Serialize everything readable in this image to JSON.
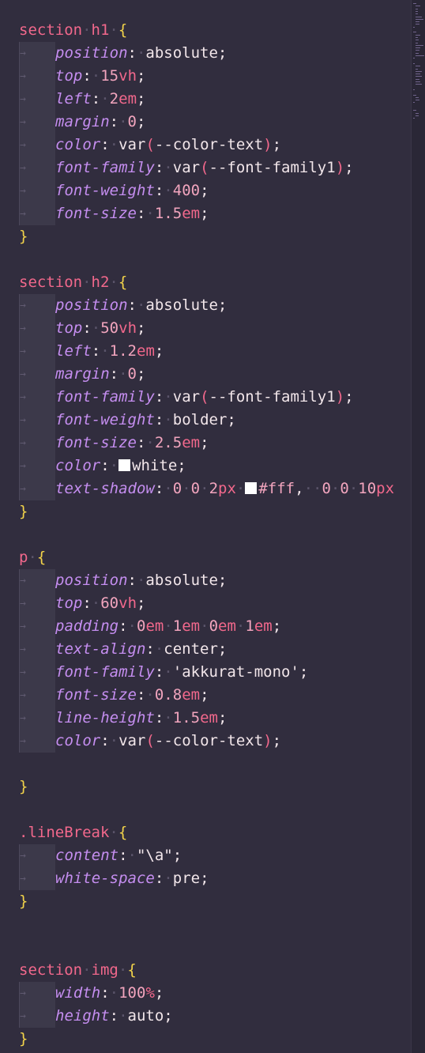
{
  "editor": {
    "language": "css",
    "theme_colors": {
      "background": "#312d3e",
      "selector": "#f2688c",
      "brace": "#f2d34a",
      "property": "#c58ef0",
      "number": "#f2a5be",
      "text": "#f2e6ea"
    },
    "code_lines": [
      {
        "indent": false,
        "tokens": [
          {
            "type": "sel",
            "text": "section"
          },
          {
            "type": "dot",
            "text": "·"
          },
          {
            "type": "sel",
            "text": "h1"
          },
          {
            "type": "dot",
            "text": "·"
          },
          {
            "type": "brace",
            "text": "{"
          }
        ]
      },
      {
        "indent": true,
        "tokens": [
          {
            "type": "prop",
            "text": "position"
          },
          {
            "type": "colon",
            "text": ":"
          },
          {
            "type": "dot",
            "text": "·"
          },
          {
            "type": "str",
            "text": "absolute;"
          }
        ]
      },
      {
        "indent": true,
        "tokens": [
          {
            "type": "prop",
            "text": "top"
          },
          {
            "type": "colon",
            "text": ":"
          },
          {
            "type": "dot",
            "text": "·"
          },
          {
            "type": "num",
            "text": "15"
          },
          {
            "type": "unit",
            "text": "vh"
          },
          {
            "type": "str",
            "text": ";"
          }
        ]
      },
      {
        "indent": true,
        "tokens": [
          {
            "type": "prop",
            "text": "left"
          },
          {
            "type": "colon",
            "text": ":"
          },
          {
            "type": "dot",
            "text": "·"
          },
          {
            "type": "num",
            "text": "2"
          },
          {
            "type": "unit",
            "text": "em"
          },
          {
            "type": "str",
            "text": ";"
          }
        ]
      },
      {
        "indent": true,
        "tokens": [
          {
            "type": "prop",
            "text": "margin"
          },
          {
            "type": "colon",
            "text": ":"
          },
          {
            "type": "dot",
            "text": "·"
          },
          {
            "type": "num",
            "text": "0"
          },
          {
            "type": "str",
            "text": ";"
          }
        ]
      },
      {
        "indent": true,
        "tokens": [
          {
            "type": "prop",
            "text": "color"
          },
          {
            "type": "colon",
            "text": ":"
          },
          {
            "type": "dot",
            "text": "·"
          },
          {
            "type": "str",
            "text": "var"
          },
          {
            "type": "paren",
            "text": "("
          },
          {
            "type": "str",
            "text": "--color-text"
          },
          {
            "type": "paren",
            "text": ")"
          },
          {
            "type": "str",
            "text": ";"
          }
        ]
      },
      {
        "indent": true,
        "tokens": [
          {
            "type": "prop",
            "text": "font-family"
          },
          {
            "type": "colon",
            "text": ":"
          },
          {
            "type": "dot",
            "text": "·"
          },
          {
            "type": "str",
            "text": "var"
          },
          {
            "type": "paren",
            "text": "("
          },
          {
            "type": "str",
            "text": "--font-family1"
          },
          {
            "type": "paren",
            "text": ")"
          },
          {
            "type": "str",
            "text": ";"
          }
        ]
      },
      {
        "indent": true,
        "tokens": [
          {
            "type": "prop",
            "text": "font-weight"
          },
          {
            "type": "colon",
            "text": ":"
          },
          {
            "type": "dot",
            "text": "·"
          },
          {
            "type": "num",
            "text": "400"
          },
          {
            "type": "str",
            "text": ";"
          }
        ]
      },
      {
        "indent": true,
        "tokens": [
          {
            "type": "prop",
            "text": "font-size"
          },
          {
            "type": "colon",
            "text": ":"
          },
          {
            "type": "dot",
            "text": "·"
          },
          {
            "type": "num",
            "text": "1.5"
          },
          {
            "type": "unit",
            "text": "em"
          },
          {
            "type": "str",
            "text": ";"
          }
        ]
      },
      {
        "indent": false,
        "tokens": [
          {
            "type": "brace",
            "text": "}"
          }
        ]
      },
      {
        "indent": false,
        "tokens": []
      },
      {
        "indent": false,
        "tokens": [
          {
            "type": "sel",
            "text": "section"
          },
          {
            "type": "dot",
            "text": "·"
          },
          {
            "type": "sel",
            "text": "h2"
          },
          {
            "type": "dot",
            "text": "·"
          },
          {
            "type": "brace",
            "text": "{"
          }
        ]
      },
      {
        "indent": true,
        "tokens": [
          {
            "type": "prop",
            "text": "position"
          },
          {
            "type": "colon",
            "text": ":"
          },
          {
            "type": "dot",
            "text": "·"
          },
          {
            "type": "str",
            "text": "absolute;"
          }
        ]
      },
      {
        "indent": true,
        "tokens": [
          {
            "type": "prop",
            "text": "top"
          },
          {
            "type": "colon",
            "text": ":"
          },
          {
            "type": "dot",
            "text": "·"
          },
          {
            "type": "num",
            "text": "50"
          },
          {
            "type": "unit",
            "text": "vh"
          },
          {
            "type": "str",
            "text": ";"
          }
        ]
      },
      {
        "indent": true,
        "tokens": [
          {
            "type": "prop",
            "text": "left"
          },
          {
            "type": "colon",
            "text": ":"
          },
          {
            "type": "dot",
            "text": "·"
          },
          {
            "type": "num",
            "text": "1.2"
          },
          {
            "type": "unit",
            "text": "em"
          },
          {
            "type": "str",
            "text": ";"
          }
        ]
      },
      {
        "indent": true,
        "tokens": [
          {
            "type": "prop",
            "text": "margin"
          },
          {
            "type": "colon",
            "text": ":"
          },
          {
            "type": "dot",
            "text": "·"
          },
          {
            "type": "num",
            "text": "0"
          },
          {
            "type": "str",
            "text": ";"
          }
        ]
      },
      {
        "indent": true,
        "tokens": [
          {
            "type": "prop",
            "text": "font-family"
          },
          {
            "type": "colon",
            "text": ":"
          },
          {
            "type": "dot",
            "text": "·"
          },
          {
            "type": "str",
            "text": "var"
          },
          {
            "type": "paren",
            "text": "("
          },
          {
            "type": "str",
            "text": "--font-family1"
          },
          {
            "type": "paren",
            "text": ")"
          },
          {
            "type": "str",
            "text": ";"
          }
        ]
      },
      {
        "indent": true,
        "tokens": [
          {
            "type": "prop",
            "text": "font-weight"
          },
          {
            "type": "colon",
            "text": ":"
          },
          {
            "type": "dot",
            "text": "·"
          },
          {
            "type": "str",
            "text": "bolder;"
          }
        ]
      },
      {
        "indent": true,
        "tokens": [
          {
            "type": "prop",
            "text": "font-size"
          },
          {
            "type": "colon",
            "text": ":"
          },
          {
            "type": "dot",
            "text": "·"
          },
          {
            "type": "num",
            "text": "2.5"
          },
          {
            "type": "unit",
            "text": "em"
          },
          {
            "type": "str",
            "text": ";"
          }
        ]
      },
      {
        "indent": true,
        "tokens": [
          {
            "type": "prop",
            "text": "color"
          },
          {
            "type": "colon",
            "text": ":"
          },
          {
            "type": "dot",
            "text": "·"
          },
          {
            "type": "swatch",
            "text": ""
          },
          {
            "type": "str",
            "text": "white;"
          }
        ]
      },
      {
        "indent": true,
        "tokens": [
          {
            "type": "prop",
            "text": "text-shadow"
          },
          {
            "type": "colon",
            "text": ":"
          },
          {
            "type": "dot",
            "text": "·"
          },
          {
            "type": "num",
            "text": "0"
          },
          {
            "type": "dot",
            "text": "·"
          },
          {
            "type": "num",
            "text": "0"
          },
          {
            "type": "dot",
            "text": "·"
          },
          {
            "type": "num",
            "text": "2"
          },
          {
            "type": "unit",
            "text": "px"
          },
          {
            "type": "dot",
            "text": "·"
          },
          {
            "type": "swatch",
            "text": ""
          },
          {
            "type": "num",
            "text": "#fff"
          },
          {
            "type": "str",
            "text": ","
          },
          {
            "type": "dot",
            "text": "··"
          },
          {
            "type": "num",
            "text": "0"
          },
          {
            "type": "dot",
            "text": "·"
          },
          {
            "type": "num",
            "text": "0"
          },
          {
            "type": "dot",
            "text": "·"
          },
          {
            "type": "num",
            "text": "10"
          },
          {
            "type": "unit",
            "text": "px"
          }
        ]
      },
      {
        "indent": false,
        "tokens": [
          {
            "type": "brace",
            "text": "}"
          }
        ]
      },
      {
        "indent": false,
        "tokens": []
      },
      {
        "indent": false,
        "tokens": [
          {
            "type": "sel",
            "text": "p"
          },
          {
            "type": "dot",
            "text": "·"
          },
          {
            "type": "brace",
            "text": "{"
          }
        ]
      },
      {
        "indent": true,
        "tokens": [
          {
            "type": "prop",
            "text": "position"
          },
          {
            "type": "colon",
            "text": ":"
          },
          {
            "type": "dot",
            "text": "·"
          },
          {
            "type": "str",
            "text": "absolute;"
          }
        ]
      },
      {
        "indent": true,
        "tokens": [
          {
            "type": "prop",
            "text": "top"
          },
          {
            "type": "colon",
            "text": ":"
          },
          {
            "type": "dot",
            "text": "·"
          },
          {
            "type": "num",
            "text": "60"
          },
          {
            "type": "unit",
            "text": "vh"
          },
          {
            "type": "str",
            "text": ";"
          }
        ]
      },
      {
        "indent": true,
        "tokens": [
          {
            "type": "prop",
            "text": "padding"
          },
          {
            "type": "colon",
            "text": ":"
          },
          {
            "type": "dot",
            "text": "·"
          },
          {
            "type": "num",
            "text": "0"
          },
          {
            "type": "unit",
            "text": "em"
          },
          {
            "type": "dot",
            "text": "·"
          },
          {
            "type": "num",
            "text": "1"
          },
          {
            "type": "unit",
            "text": "em"
          },
          {
            "type": "dot",
            "text": "·"
          },
          {
            "type": "num",
            "text": "0"
          },
          {
            "type": "unit",
            "text": "em"
          },
          {
            "type": "dot",
            "text": "·"
          },
          {
            "type": "num",
            "text": "1"
          },
          {
            "type": "unit",
            "text": "em"
          },
          {
            "type": "str",
            "text": ";"
          }
        ]
      },
      {
        "indent": true,
        "tokens": [
          {
            "type": "prop",
            "text": "text-align"
          },
          {
            "type": "colon",
            "text": ":"
          },
          {
            "type": "dot",
            "text": "·"
          },
          {
            "type": "str",
            "text": "center;"
          }
        ]
      },
      {
        "indent": true,
        "tokens": [
          {
            "type": "prop",
            "text": "font-family"
          },
          {
            "type": "colon",
            "text": ":"
          },
          {
            "type": "dot",
            "text": "·"
          },
          {
            "type": "str",
            "text": "'akkurat-mono';"
          }
        ]
      },
      {
        "indent": true,
        "tokens": [
          {
            "type": "prop",
            "text": "font-size"
          },
          {
            "type": "colon",
            "text": ":"
          },
          {
            "type": "dot",
            "text": "·"
          },
          {
            "type": "num",
            "text": "0.8"
          },
          {
            "type": "unit",
            "text": "em"
          },
          {
            "type": "str",
            "text": ";"
          }
        ]
      },
      {
        "indent": true,
        "tokens": [
          {
            "type": "prop",
            "text": "line-height"
          },
          {
            "type": "colon",
            "text": ":"
          },
          {
            "type": "dot",
            "text": "·"
          },
          {
            "type": "num",
            "text": "1.5"
          },
          {
            "type": "unit",
            "text": "em"
          },
          {
            "type": "str",
            "text": ";"
          }
        ]
      },
      {
        "indent": true,
        "tokens": [
          {
            "type": "prop",
            "text": "color"
          },
          {
            "type": "colon",
            "text": ":"
          },
          {
            "type": "dot",
            "text": "·"
          },
          {
            "type": "str",
            "text": "var"
          },
          {
            "type": "paren",
            "text": "("
          },
          {
            "type": "str",
            "text": "--color-text"
          },
          {
            "type": "paren",
            "text": ")"
          },
          {
            "type": "str",
            "text": ";"
          }
        ]
      },
      {
        "indent": false,
        "tokens": []
      },
      {
        "indent": false,
        "tokens": [
          {
            "type": "brace",
            "text": "}"
          }
        ]
      },
      {
        "indent": false,
        "tokens": []
      },
      {
        "indent": false,
        "tokens": [
          {
            "type": "sel",
            "text": ".lineBreak"
          },
          {
            "type": "dot",
            "text": "·"
          },
          {
            "type": "brace",
            "text": "{"
          }
        ]
      },
      {
        "indent": true,
        "tokens": [
          {
            "type": "prop",
            "text": "content"
          },
          {
            "type": "colon",
            "text": ":"
          },
          {
            "type": "dot",
            "text": "·"
          },
          {
            "type": "str",
            "text": "\"\\a\";"
          }
        ]
      },
      {
        "indent": true,
        "tokens": [
          {
            "type": "prop",
            "text": "white-space"
          },
          {
            "type": "colon",
            "text": ":"
          },
          {
            "type": "dot",
            "text": "·"
          },
          {
            "type": "str",
            "text": "pre;"
          }
        ]
      },
      {
        "indent": false,
        "tokens": [
          {
            "type": "brace",
            "text": "}"
          }
        ]
      },
      {
        "indent": false,
        "tokens": []
      },
      {
        "indent": false,
        "tokens": []
      },
      {
        "indent": false,
        "tokens": [
          {
            "type": "sel",
            "text": "section"
          },
          {
            "type": "dot",
            "text": "·"
          },
          {
            "type": "sel",
            "text": "img"
          },
          {
            "type": "dot",
            "text": "·"
          },
          {
            "type": "brace",
            "text": "{"
          }
        ]
      },
      {
        "indent": true,
        "tokens": [
          {
            "type": "prop",
            "text": "width"
          },
          {
            "type": "colon",
            "text": ":"
          },
          {
            "type": "dot",
            "text": "·"
          },
          {
            "type": "num",
            "text": "100"
          },
          {
            "type": "unit",
            "text": "%"
          },
          {
            "type": "str",
            "text": ";"
          }
        ]
      },
      {
        "indent": true,
        "tokens": [
          {
            "type": "prop",
            "text": "height"
          },
          {
            "type": "colon",
            "text": ":"
          },
          {
            "type": "dot",
            "text": "·"
          },
          {
            "type": "str",
            "text": "auto;"
          }
        ]
      },
      {
        "indent": false,
        "tokens": [
          {
            "type": "brace",
            "text": "}"
          }
        ]
      }
    ]
  }
}
